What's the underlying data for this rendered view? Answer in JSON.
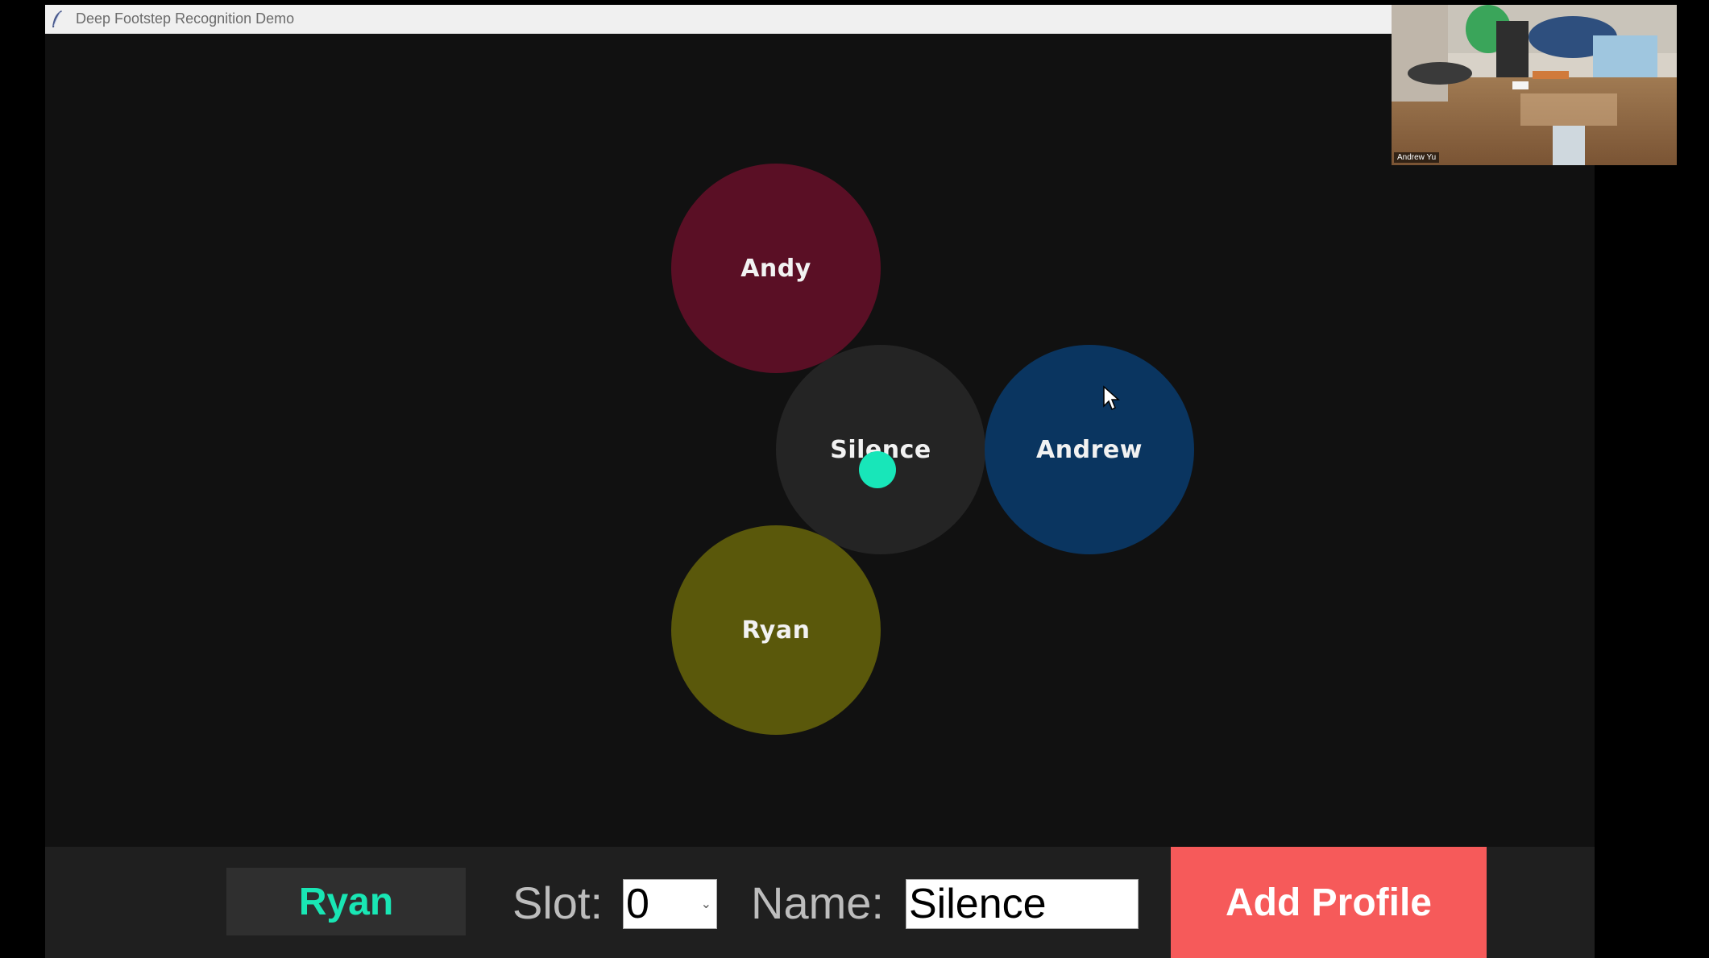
{
  "window": {
    "title": "Deep Footstep Recognition Demo",
    "app_icon": "feather-icon"
  },
  "canvas": {
    "background": "#111111",
    "profiles": [
      {
        "name": "Andy",
        "color": "#5a0f25"
      },
      {
        "name": "Silence",
        "color": "#242424"
      },
      {
        "name": "Andrew",
        "color": "#0a3560"
      },
      {
        "name": "Ryan",
        "color": "#5a580b"
      }
    ],
    "marker_color": "#18e6b9"
  },
  "webcam": {
    "participant_name": "Andrew Yu"
  },
  "controls": {
    "current_profile": "Ryan",
    "current_profile_color": "#19e6b4",
    "slot_label": "Slot:",
    "slot_value": "0",
    "name_label": "Name:",
    "name_value": "Silence",
    "add_button_label": "Add Profile",
    "add_button_color": "#f65a5a"
  }
}
